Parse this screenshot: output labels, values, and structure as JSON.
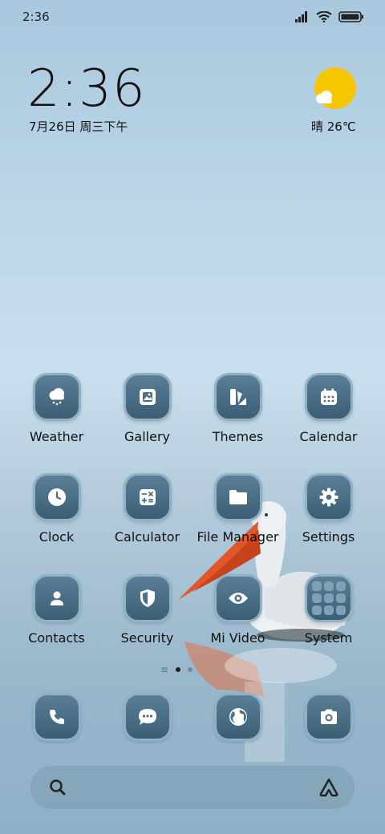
{
  "status_bar": {
    "time": "2:36"
  },
  "clock_widget": {
    "time": "2:36",
    "date": "7月26日 周三下午"
  },
  "weather_widget": {
    "text": "晴 26℃"
  },
  "apps": [
    {
      "label": "Weather",
      "icon": "cloud-snow-icon"
    },
    {
      "label": "Gallery",
      "icon": "image-icon"
    },
    {
      "label": "Themes",
      "icon": "themes-icon"
    },
    {
      "label": "Calendar",
      "icon": "calendar-icon"
    },
    {
      "label": "Clock",
      "icon": "clock-icon"
    },
    {
      "label": "Calculator",
      "icon": "calculator-icon"
    },
    {
      "label": "File Manager",
      "icon": "folder-icon"
    },
    {
      "label": "Settings",
      "icon": "gear-icon"
    },
    {
      "label": "Contacts",
      "icon": "person-icon"
    },
    {
      "label": "Security",
      "icon": "shield-icon"
    },
    {
      "label": "Mi Video",
      "icon": "eye-icon"
    },
    {
      "label": "System",
      "icon": "folder-grid-icon"
    }
  ],
  "dock": [
    {
      "icon": "phone-icon"
    },
    {
      "icon": "message-icon"
    },
    {
      "icon": "globe-icon"
    },
    {
      "icon": "camera-icon"
    }
  ],
  "colors": {
    "icon_bg": "#4a6f86",
    "sun": "#f7c600"
  }
}
